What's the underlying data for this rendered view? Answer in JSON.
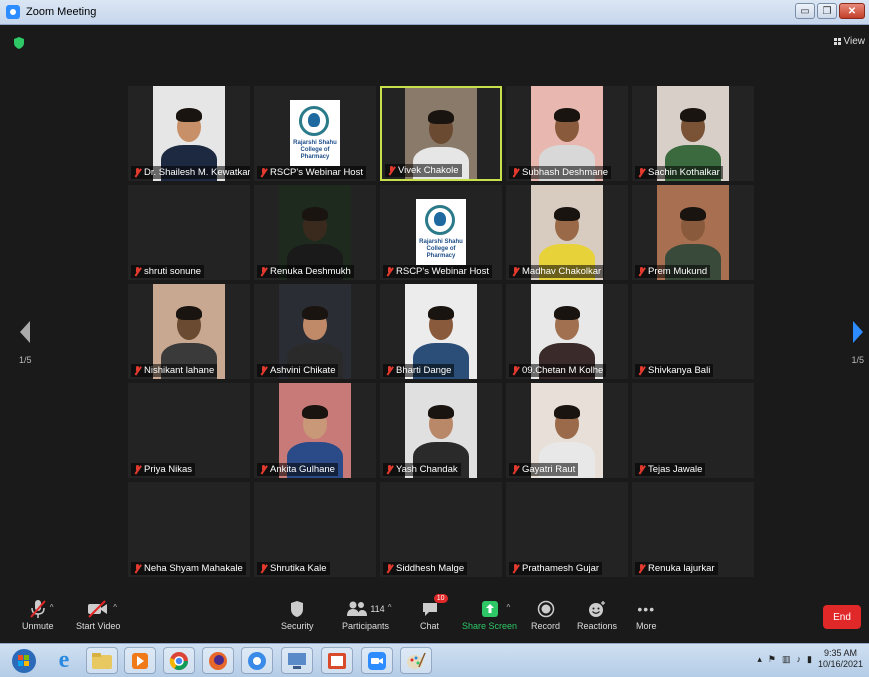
{
  "window": {
    "title": "Zoom Meeting"
  },
  "view_label": "View",
  "pager": {
    "left": "1/5",
    "right": "1/5"
  },
  "participants": [
    {
      "name": "Dr. Shailesh M. Kewatkar",
      "type": "photo",
      "bg": "#e6e6e6",
      "skin": "#c89068",
      "shirt": "#1d2940"
    },
    {
      "name": "RSCP's Webinar Host",
      "type": "logo"
    },
    {
      "name": "Vivek Chakole",
      "type": "photo",
      "bg": "#8a7a6a",
      "skin": "#6b4a32",
      "shirt": "#e6e6e6",
      "active": true
    },
    {
      "name": "Subhash Deshmane",
      "type": "photo",
      "bg": "#e8b8b0",
      "skin": "#8a5a3c",
      "shirt": "#d8d8d8"
    },
    {
      "name": "Sachin Kothalkar",
      "type": "photo",
      "bg": "#d8d0c8",
      "skin": "#7a5236",
      "shirt": "#3a6a3e"
    },
    {
      "name": "shruti sonune",
      "type": "none"
    },
    {
      "name": "Renuka Deshmukh",
      "type": "photo",
      "bg": "#1e2a1e",
      "skin": "#3a2a1e",
      "shirt": "#1a1a1a"
    },
    {
      "name": "RSCP's Webinar Host",
      "type": "logo"
    },
    {
      "name": "Madhav Chakolkar",
      "type": "photo",
      "bg": "#d8ccc0",
      "skin": "#9a6a48",
      "shirt": "#e8d23a"
    },
    {
      "name": "Prem Mukund",
      "type": "photo",
      "bg": "#a87050",
      "skin": "#8a5a3c",
      "shirt": "#3a4a3a"
    },
    {
      "name": "Nishikant lahane",
      "type": "photo",
      "bg": "#c8a890",
      "skin": "#6a4a30",
      "shirt": "#3a3a3a"
    },
    {
      "name": "Ashvini Chikate",
      "type": "photo",
      "bg": "#2a2e34",
      "skin": "#c08a68",
      "shirt": "#2a2a2a"
    },
    {
      "name": "Bharti Dange",
      "type": "photo",
      "bg": "#ececec",
      "skin": "#8a5a3c",
      "shirt": "#2a4e78"
    },
    {
      "name": "09.Chetan M Kolhe",
      "type": "photo",
      "bg": "#e8e8e8",
      "skin": "#a07050",
      "shirt": "#3a2a2a"
    },
    {
      "name": "Shivkanya Bali",
      "type": "none"
    },
    {
      "name": "Priya Nikas",
      "type": "none"
    },
    {
      "name": "Ankita Gulhane",
      "type": "photo",
      "bg": "#c87a78",
      "skin": "#c89878",
      "shirt": "#2a4a88"
    },
    {
      "name": "Yash Chandak",
      "type": "photo",
      "bg": "#e0e0e0",
      "skin": "#b88868",
      "shirt": "#2a2a2a"
    },
    {
      "name": "Gayatri Raut",
      "type": "photo",
      "bg": "#e8e0d8",
      "skin": "#9a6a4a",
      "shirt": "#e8e8e8"
    },
    {
      "name": "Tejas Jawale",
      "type": "none"
    },
    {
      "name": "Neha Shyam Mahakale",
      "type": "none"
    },
    {
      "name": "Shrutika Kale",
      "type": "none"
    },
    {
      "name": "Siddhesh Malge",
      "type": "none"
    },
    {
      "name": "Prathamesh Gujar",
      "type": "none"
    },
    {
      "name": "Renuka lajurkar",
      "type": "none"
    }
  ],
  "logo_text": "Rajarshi Shahu College of Pharmacy",
  "toolbar": {
    "unmute": "Unmute",
    "start_video": "Start Video",
    "security": "Security",
    "participants": "Participants",
    "participants_count": "114",
    "chat": "Chat",
    "chat_badge": "10",
    "share_screen": "Share Screen",
    "record": "Record",
    "reactions": "Reactions",
    "more": "More",
    "end": "End"
  },
  "clock": {
    "time": "9:35 AM",
    "date": "10/16/2021"
  },
  "colors": {
    "accent_blue": "#2d8cff",
    "end_red": "#e02828",
    "share_green": "#2ec866",
    "active_border": "#c8e04a"
  }
}
